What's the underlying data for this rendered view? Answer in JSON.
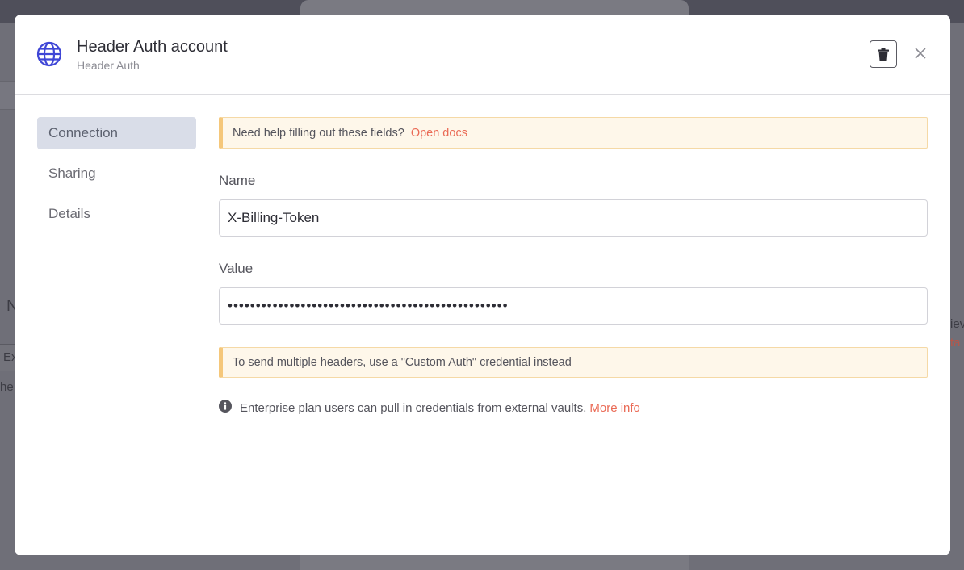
{
  "background": {
    "left_heading_fragment": "N",
    "left_input_fragment": "Ex",
    "left_text_fragment": "he",
    "right_text_fragment": "iev",
    "right_link_fragment": "ta"
  },
  "modal": {
    "title": "Header Auth account",
    "subtitle": "Header Auth",
    "icons": {
      "header": "globe-icon",
      "delete": "trash-icon",
      "close": "close-icon",
      "info": "info-icon"
    }
  },
  "sidebar": {
    "items": [
      {
        "label": "Connection",
        "active": true
      },
      {
        "label": "Sharing",
        "active": false
      },
      {
        "label": "Details",
        "active": false
      }
    ]
  },
  "connection": {
    "help_notice": {
      "text": "Need help filling out these fields?",
      "link": "Open docs"
    },
    "name_field": {
      "label": "Name",
      "value": "X-Billing-Token"
    },
    "value_field": {
      "label": "Value",
      "value": "••••••••••••••••••••••••••••••••••••••••••••••••••"
    },
    "multi_header_notice": "To send multiple headers, use a \"Custom Auth\" credential instead",
    "vault_info": {
      "text": "Enterprise plan users can pull in credentials from external vaults.",
      "link": "More info"
    }
  },
  "colors": {
    "accent_link": "#ea6a55",
    "globe_icon": "#3f46d6",
    "notice_background": "#fef7ea",
    "notice_border": "#f5c77a",
    "active_nav_background": "#d9dde8"
  }
}
